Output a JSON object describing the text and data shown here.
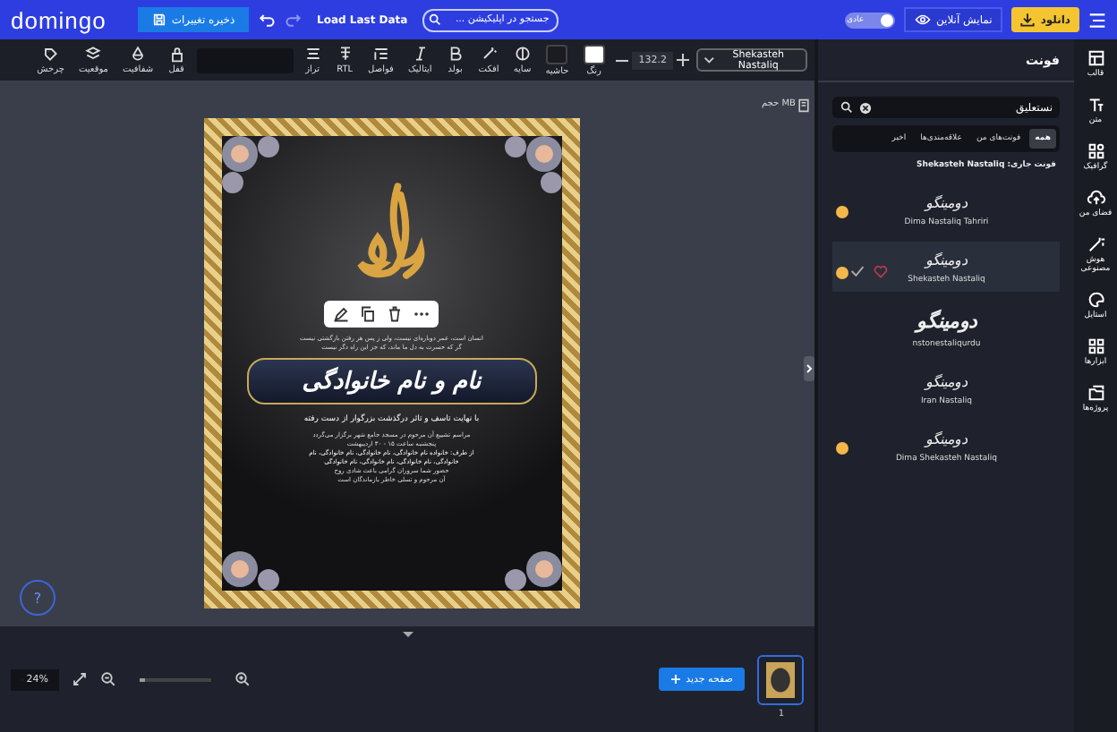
{
  "topbar": {
    "logo": "domingo",
    "save_button": "ذخیره تغییرات",
    "load_button": "Load Last Data",
    "search": {
      "placeholder": "جستجو در اپلیکیشن ..."
    },
    "mode_toggle": {
      "label": "عادی",
      "on": true
    },
    "preview_button": "نمایش آنلاین",
    "download_button": "دانلود"
  },
  "toolbar": {
    "font_select": "Shekasteh Nastaliq",
    "font_size": "132.2",
    "text_tools": [
      {
        "label": "رنگ",
        "kind": "swatch",
        "color": "#ffffff"
      },
      {
        "label": "حاشیه",
        "kind": "swatch",
        "color": "#1a1c22"
      },
      {
        "label": "سایه",
        "kind": "icon"
      },
      {
        "label": "افکت",
        "kind": "icon"
      },
      {
        "label": "بولد",
        "kind": "icon"
      },
      {
        "label": "ایتالیک",
        "kind": "icon"
      },
      {
        "label": "فواصل",
        "kind": "icon"
      },
      {
        "label": "RTL",
        "kind": "icon"
      },
      {
        "label": "تراز",
        "kind": "icon"
      }
    ],
    "object_tools": [
      {
        "label": "قفل"
      },
      {
        "label": "شفافیت"
      },
      {
        "label": "موقعیت"
      },
      {
        "label": "چرخش"
      }
    ]
  },
  "canvas": {
    "file_size": "حجم MB",
    "poster": {
      "intro_lines": [
        "انسان است، عمر دوباره‌ای نیست، ولی ز پس هر رفتن بازگشتی نیست",
        "گر که حسرت به دل ما ماند، که جز این راه دگر نیست"
      ],
      "title": "نام و نام خانوادگی",
      "subtitle": "با نهایت تاسف و تاثر درگذشت بزرگوار از دست رفته",
      "details": [
        "مراسم تشییع آن مرحوم در مسجد جامع شهر برگزار می‌گردد",
        "پنجشنبه ساعت ۱۵ - ۳۰ اردیبهشت"
      ],
      "families": [
        "از طرف: خانواده نام خانوادگی، نام خانوادگی، نام خانوادگی، نام",
        "خانوادگی، نام خانوادگی، نام خانوادگی، نام خانوادگی"
      ],
      "footer": [
        "حضور شما سروران گرامی باعث شادی روح",
        "آن مرحوم و تسلی خاطر بازماندگان است"
      ]
    },
    "help": "?"
  },
  "panel": {
    "title": "فونت",
    "search": {
      "value": "نستعلیق"
    },
    "tabs": [
      {
        "label": "همه",
        "selected": true
      },
      {
        "label": "فونت‌های من",
        "selected": false
      },
      {
        "label": "علاقه‌مندی‌ها",
        "selected": false
      },
      {
        "label": "اخیر",
        "selected": false
      }
    ],
    "current_font": "فونت جاری: Shekasteh Nastaliq",
    "fonts": [
      {
        "preview": "دومینگو",
        "name": "Dima Nastaliq Tahriri",
        "premium": true,
        "selected": false
      },
      {
        "preview": "دومینگو",
        "name": "Shekasteh Nastaliq",
        "premium": true,
        "selected": true
      },
      {
        "preview": "دومینگو",
        "name": "nstonestaliqurdu",
        "premium": false,
        "selected": false
      },
      {
        "preview": "دومینگو",
        "name": "Iran Nastaliq",
        "premium": false,
        "selected": false
      },
      {
        "preview": "دومینگو",
        "name": "Dima Shekasteh Nastaliq",
        "premium": true,
        "selected": false
      }
    ]
  },
  "sidebar": [
    {
      "label": "قالب"
    },
    {
      "label": "متن"
    },
    {
      "label": "گرافیک"
    },
    {
      "label": "فضای من"
    },
    {
      "label": "هوش مصنوعی"
    },
    {
      "label": "استایل"
    },
    {
      "label": "ابزارها"
    },
    {
      "label": "پروژه‌ها"
    }
  ],
  "bottom": {
    "zoom": "24%",
    "zoom_slider": {
      "level": 0.08
    },
    "new_page_button": "صفحه جدید",
    "pages": [
      {
        "number": "1",
        "selected": true
      }
    ]
  }
}
